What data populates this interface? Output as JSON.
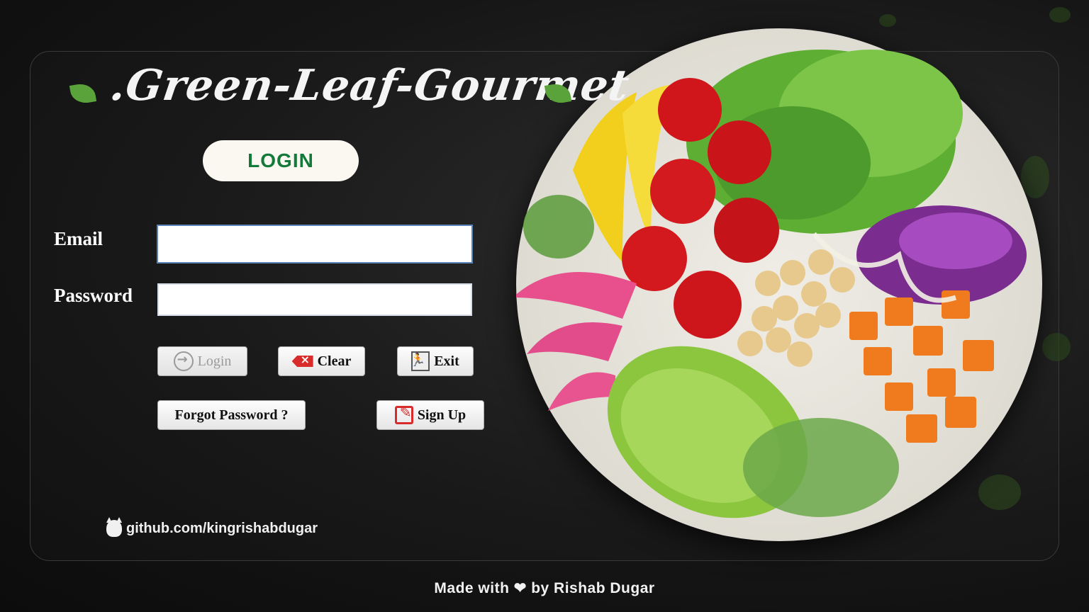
{
  "app": {
    "brand": ".Green-Leaf-Gourmet",
    "heading": "LOGIN"
  },
  "form": {
    "email_label": "Email",
    "password_label": "Password",
    "email_value": "",
    "password_value": ""
  },
  "buttons": {
    "login": "Login",
    "clear": "Clear",
    "exit": "Exit",
    "forgot": "Forgot Password ?",
    "signup": "Sign Up"
  },
  "links": {
    "github": "github.com/kingrishabdugar"
  },
  "footer": {
    "text": "Made with ❤ by Rishab Dugar"
  },
  "icons": {
    "title_left": "leaf-icon",
    "title_right": "leaf-icon",
    "login": "login-arrow-icon",
    "clear": "backspace-icon",
    "exit": "exit-door-icon",
    "signup": "edit-icon",
    "github": "github-icon"
  },
  "colors": {
    "brand_green": "#137a3a",
    "leaf": "#5aa33a",
    "background": "#161616"
  }
}
